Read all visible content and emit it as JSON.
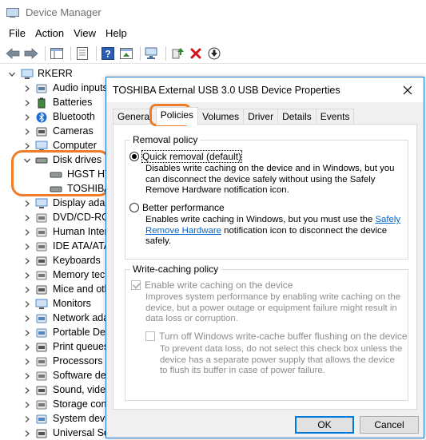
{
  "window": {
    "title": "Device Manager"
  },
  "menu": [
    "File",
    "Action",
    "View",
    "Help"
  ],
  "tree": {
    "root": "RKERR",
    "items": [
      {
        "label": "Audio inputs",
        "icon": "speaker-icon",
        "color": "#5a7fa8"
      },
      {
        "label": "Batteries",
        "icon": "battery-icon",
        "color": "#3d8a3d"
      },
      {
        "label": "Bluetooth",
        "icon": "bluetooth-icon",
        "color": "#1f6fd1"
      },
      {
        "label": "Cameras",
        "icon": "camera-icon",
        "color": "#555555"
      },
      {
        "label": "Computer",
        "icon": "computer-icon",
        "color": "#4f88c6"
      },
      {
        "label": "Disk drives",
        "icon": "disk-drive-icon",
        "color": "#555555",
        "expanded": true
      },
      {
        "label": "HGST HT",
        "icon": "disk-drive-icon",
        "color": "#555555",
        "child": true
      },
      {
        "label": "TOSHIBA",
        "icon": "disk-drive-icon",
        "color": "#555555",
        "child": true
      },
      {
        "label": "Display adap",
        "icon": "display-icon",
        "color": "#4f88c6"
      },
      {
        "label": "DVD/CD-RO",
        "icon": "dvd-icon",
        "color": "#777777"
      },
      {
        "label": "Human Inter",
        "icon": "hid-icon",
        "color": "#777777"
      },
      {
        "label": "IDE ATA/ATA",
        "icon": "ide-icon",
        "color": "#777777"
      },
      {
        "label": "Keyboards",
        "icon": "keyboard-icon",
        "color": "#555555"
      },
      {
        "label": "Memory tech",
        "icon": "memory-icon",
        "color": "#777777"
      },
      {
        "label": "Mice and oth",
        "icon": "mouse-icon",
        "color": "#555555"
      },
      {
        "label": "Monitors",
        "icon": "monitor-icon",
        "color": "#4f88c6"
      },
      {
        "label": "Network ada",
        "icon": "network-icon",
        "color": "#4f88c6"
      },
      {
        "label": "Portable Dev",
        "icon": "portable-device-icon",
        "color": "#4f88c6"
      },
      {
        "label": "Print queues",
        "icon": "printer-icon",
        "color": "#555555"
      },
      {
        "label": "Processors",
        "icon": "processor-icon",
        "color": "#777777"
      },
      {
        "label": "Software dev",
        "icon": "software-device-icon",
        "color": "#777777"
      },
      {
        "label": "Sound, video",
        "icon": "sound-icon",
        "color": "#555555"
      },
      {
        "label": "Storage cont",
        "icon": "storage-icon",
        "color": "#777777"
      },
      {
        "label": "System devic",
        "icon": "system-device-icon",
        "color": "#4f88c6"
      },
      {
        "label": "Universal Ser",
        "icon": "usb-icon",
        "color": "#555555"
      }
    ]
  },
  "dialog": {
    "title": "TOSHIBA External USB 3.0 USB Device Properties",
    "tabs": [
      "General",
      "Policies",
      "Volumes",
      "Driver",
      "Details",
      "Events"
    ],
    "active_tab": "Policies",
    "removal": {
      "legend": "Removal policy",
      "quick_label": "Quick removal (default)",
      "quick_desc": "Disables write caching on the device and in Windows, but you can disconnect the device safely without using the Safely Remove Hardware notification icon.",
      "better_label": "Better performance",
      "better_desc_before": "Enables write caching in Windows, but you must use the",
      "better_link": "Safely Remove Hardware",
      "better_desc_after": "notification icon to disconnect the device safely."
    },
    "caching": {
      "legend": "Write-caching policy",
      "enable_label": "Enable write caching on the device",
      "enable_desc": "Improves system performance by enabling write caching on the device, but a power outage or equipment failure might result in data loss or corruption.",
      "flush_label": "Turn off Windows write-cache buffer flushing on the device",
      "flush_desc": "To prevent data loss, do not select this check box unless the device has a separate power supply that allows the device to flush its buffer in case of power failure."
    },
    "ok_label": "OK",
    "cancel_label": "Cancel"
  },
  "colors": {
    "accent": "#0078d7",
    "annotation": "#ee7d2a",
    "link": "#0066cc"
  }
}
